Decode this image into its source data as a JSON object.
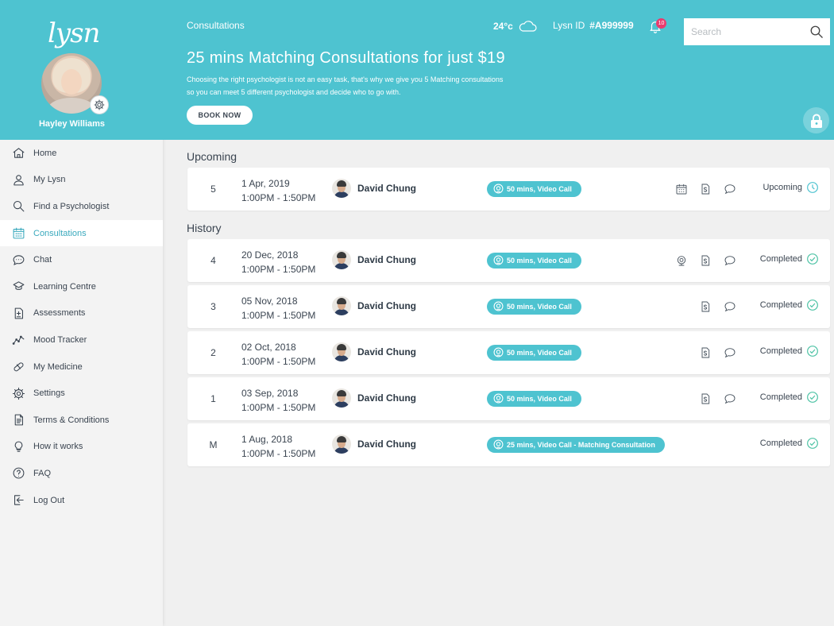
{
  "sidebar": {
    "logo": "lysn",
    "user_name": "Hayley Williams",
    "items": [
      {
        "label": "Home",
        "icon": "home-icon"
      },
      {
        "label": "My Lysn",
        "icon": "user-icon"
      },
      {
        "label": "Find a Psychologist",
        "icon": "search-icon"
      },
      {
        "label": "Consultations",
        "icon": "calendar-icon",
        "active": true
      },
      {
        "label": "Chat",
        "icon": "chat-icon"
      },
      {
        "label": "Learning Centre",
        "icon": "learning-icon"
      },
      {
        "label": "Assessments",
        "icon": "assessment-icon"
      },
      {
        "label": "Mood Tracker",
        "icon": "mood-tracker-icon"
      },
      {
        "label": "My Medicine",
        "icon": "pill-icon"
      },
      {
        "label": "Settings",
        "icon": "gear-icon"
      },
      {
        "label": "Terms & Conditions",
        "icon": "document-icon"
      },
      {
        "label": "How it works",
        "icon": "lightbulb-icon"
      },
      {
        "label": "FAQ",
        "icon": "question-icon"
      },
      {
        "label": "Log Out",
        "icon": "logout-icon"
      }
    ]
  },
  "header": {
    "breadcrumb": "Consultations",
    "temperature": "24°c",
    "lysn_id_label": "Lysn ID",
    "lysn_id_value": "#A999999",
    "notification_count": "10",
    "search_placeholder": "Search",
    "promo_title": "25 mins Matching Consultations for just $19",
    "promo_description": "Choosing the right psychologist is not an easy task, that's why we give you 5 Matching consultations so you can meet 5 different psychologist and decide who to go with.",
    "book_now_label": "BOOK NOW"
  },
  "sections": {
    "upcoming_title": "Upcoming",
    "history_title": "History"
  },
  "upcoming": [
    {
      "num": "5",
      "date": "1 Apr, 2019",
      "time": "1:00PM - 1:50PM",
      "doctor": "David Chung",
      "session": "50 mins, Video Call",
      "status": "Upcoming"
    }
  ],
  "history": [
    {
      "num": "4",
      "date": "20 Dec, 2018",
      "time": "1:00PM - 1:50PM",
      "doctor": "David Chung",
      "session": "50 mins, Video Call",
      "status": "Completed"
    },
    {
      "num": "3",
      "date": "05 Nov, 2018",
      "time": "1:00PM - 1:50PM",
      "doctor": "David Chung",
      "session": "50 mins, Video Call",
      "status": "Completed"
    },
    {
      "num": "2",
      "date": "02 Oct, 2018",
      "time": "1:00PM - 1:50PM",
      "doctor": "David Chung",
      "session": "50 mins, Video Call",
      "status": "Completed"
    },
    {
      "num": "1",
      "date": "03 Sep, 2018",
      "time": "1:00PM - 1:50PM",
      "doctor": "David Chung",
      "session": "50 mins, Video Call",
      "status": "Completed"
    },
    {
      "num": "M",
      "date": "1 Aug, 2018",
      "time": "1:00PM - 1:50PM",
      "doctor": "David Chung",
      "session": "25 mins, Video Call - Matching Consultation",
      "status": "Completed"
    }
  ],
  "colors": {
    "accent": "#4ec3d0",
    "badge": "#e93b6e",
    "success": "#4ec3a5"
  }
}
